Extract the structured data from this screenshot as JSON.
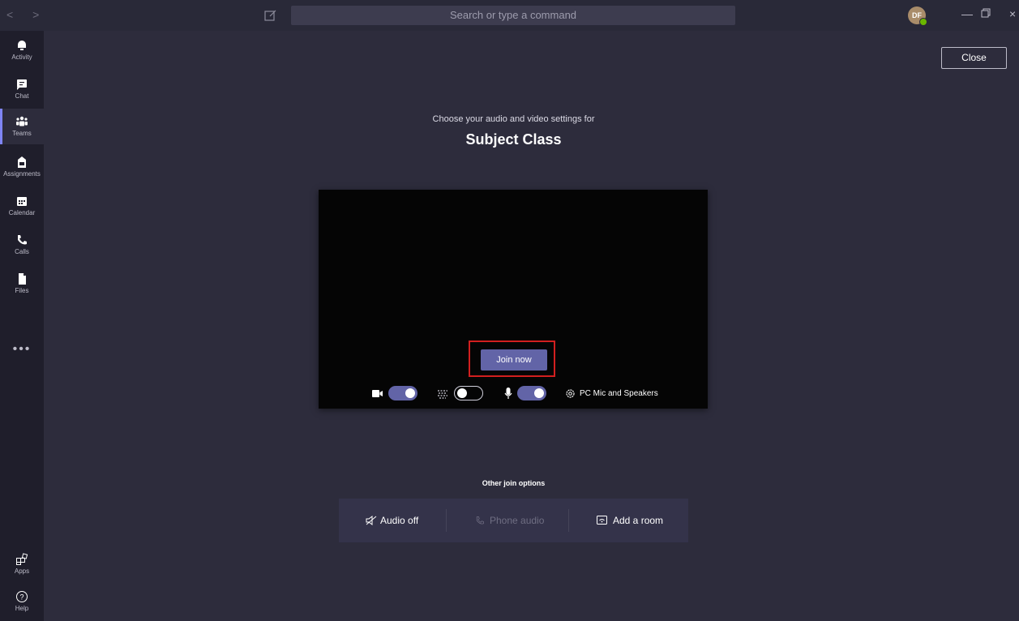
{
  "titlebar": {
    "search_placeholder": "Search or type a command",
    "avatar_initials": "DF"
  },
  "sidebar": {
    "items": [
      {
        "label": "Activity",
        "icon": "bell-icon"
      },
      {
        "label": "Chat",
        "icon": "chat-icon"
      },
      {
        "label": "Teams",
        "icon": "teams-icon",
        "active": true
      },
      {
        "label": "Assignments",
        "icon": "assignments-icon"
      },
      {
        "label": "Calendar",
        "icon": "calendar-icon"
      },
      {
        "label": "Calls",
        "icon": "phone-icon"
      },
      {
        "label": "Files",
        "icon": "file-icon"
      }
    ],
    "more": "•••",
    "bottom": [
      {
        "label": "Apps",
        "icon": "apps-icon"
      },
      {
        "label": "Help",
        "icon": "help-icon"
      }
    ]
  },
  "main": {
    "close_label": "Close",
    "subtitle": "Choose your audio and video settings for",
    "title": "Subject Class",
    "join_label": "Join now",
    "video_on": true,
    "background_blur_on": false,
    "mic_on": true,
    "device_label": "PC Mic and Speakers",
    "other_title": "Other join options",
    "options": {
      "audio_off": "Audio off",
      "phone_audio": "Phone audio",
      "add_room": "Add a room"
    }
  },
  "colors": {
    "accent": "#6264a7",
    "highlight": "#d21f1f",
    "background": "#2d2c3c",
    "sidebar": "#1f1e2b"
  }
}
